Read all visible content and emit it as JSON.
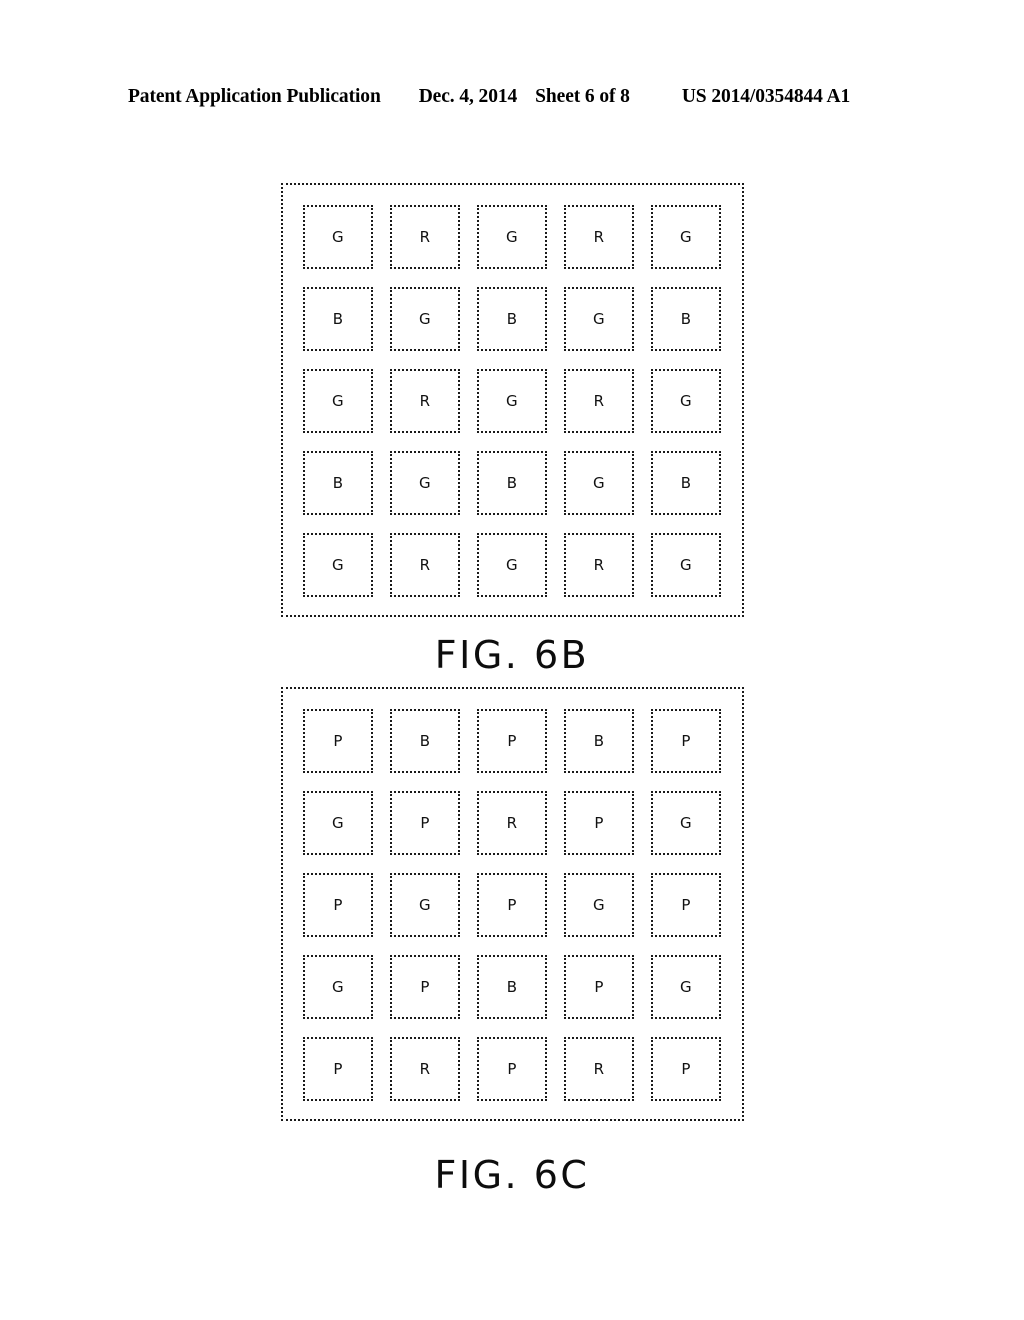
{
  "header": {
    "publication_line": "Patent Application Publication",
    "date": "Dec. 4, 2014",
    "sheet": "Sheet 6 of 8",
    "publication_number": "US 2014/0354844 A1"
  },
  "figures": [
    {
      "id": "6B",
      "caption": "FIG. 6B",
      "rows": 5,
      "cols": 5,
      "grid": [
        [
          "G",
          "R",
          "G",
          "R",
          "G"
        ],
        [
          "B",
          "G",
          "B",
          "G",
          "B"
        ],
        [
          "G",
          "R",
          "G",
          "R",
          "G"
        ],
        [
          "B",
          "G",
          "B",
          "G",
          "B"
        ],
        [
          "G",
          "R",
          "G",
          "R",
          "G"
        ]
      ]
    },
    {
      "id": "6C",
      "caption": "FIG. 6C",
      "rows": 5,
      "cols": 5,
      "grid": [
        [
          "P",
          "B",
          "P",
          "B",
          "P"
        ],
        [
          "G",
          "P",
          "R",
          "P",
          "G"
        ],
        [
          "P",
          "G",
          "P",
          "G",
          "P"
        ],
        [
          "G",
          "P",
          "B",
          "P",
          "G"
        ],
        [
          "P",
          "R",
          "P",
          "R",
          "P"
        ]
      ]
    }
  ],
  "colors": {
    "ink": "#000000",
    "page": "#ffffff",
    "line": "#1a1a1a"
  }
}
